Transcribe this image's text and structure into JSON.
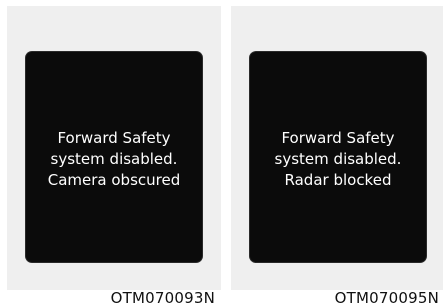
{
  "panels": [
    {
      "message_lines": [
        "Forward Safety",
        "system disabled.",
        "Camera obscured"
      ],
      "code": "OTM070093N"
    },
    {
      "message_lines": [
        "Forward Safety",
        "system disabled.",
        "Radar blocked"
      ],
      "code": "OTM070095N"
    }
  ],
  "colors": {
    "panel_background": "#efefef",
    "screen_background": "#0b0b0b",
    "screen_text": "#ffffff",
    "code_text": "#111111"
  }
}
